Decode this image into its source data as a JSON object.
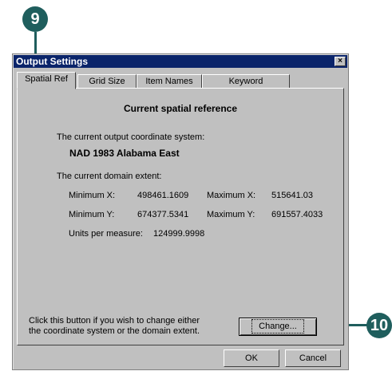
{
  "callouts": {
    "step_a": "9",
    "step_b": "10"
  },
  "window": {
    "title": "Output Settings",
    "close_glyph": "×"
  },
  "tabs": [
    {
      "label": "Spatial Ref"
    },
    {
      "label": "Grid Size"
    },
    {
      "label": "Item Names"
    },
    {
      "label": "Keyword"
    }
  ],
  "panel": {
    "heading": "Current spatial reference",
    "coord_label": "The current output coordinate system:",
    "coord_system": "NAD 1983 Alabama East",
    "domain_label": "The current domain extent:",
    "min_x_label": "Minimum X:",
    "min_x_value": "498461.1609",
    "max_x_label": "Maximum X:",
    "max_x_value": "515641.03",
    "min_y_label": "Minimum Y:",
    "min_y_value": "674377.5341",
    "max_y_label": "Maximum Y:",
    "max_y_value": "691557.4033",
    "units_label": "Units per measure:",
    "units_value": "124999.9998",
    "change_hint_line1": "Click this button if you wish to change either",
    "change_hint_line2": "the coordinate system or the domain extent.",
    "change_button": "Change..."
  },
  "footer": {
    "ok": "OK",
    "cancel": "Cancel"
  },
  "colors": {
    "callout": "#1f5e5d",
    "titlebar": "#0a246a",
    "face": "#c0c0c0"
  }
}
